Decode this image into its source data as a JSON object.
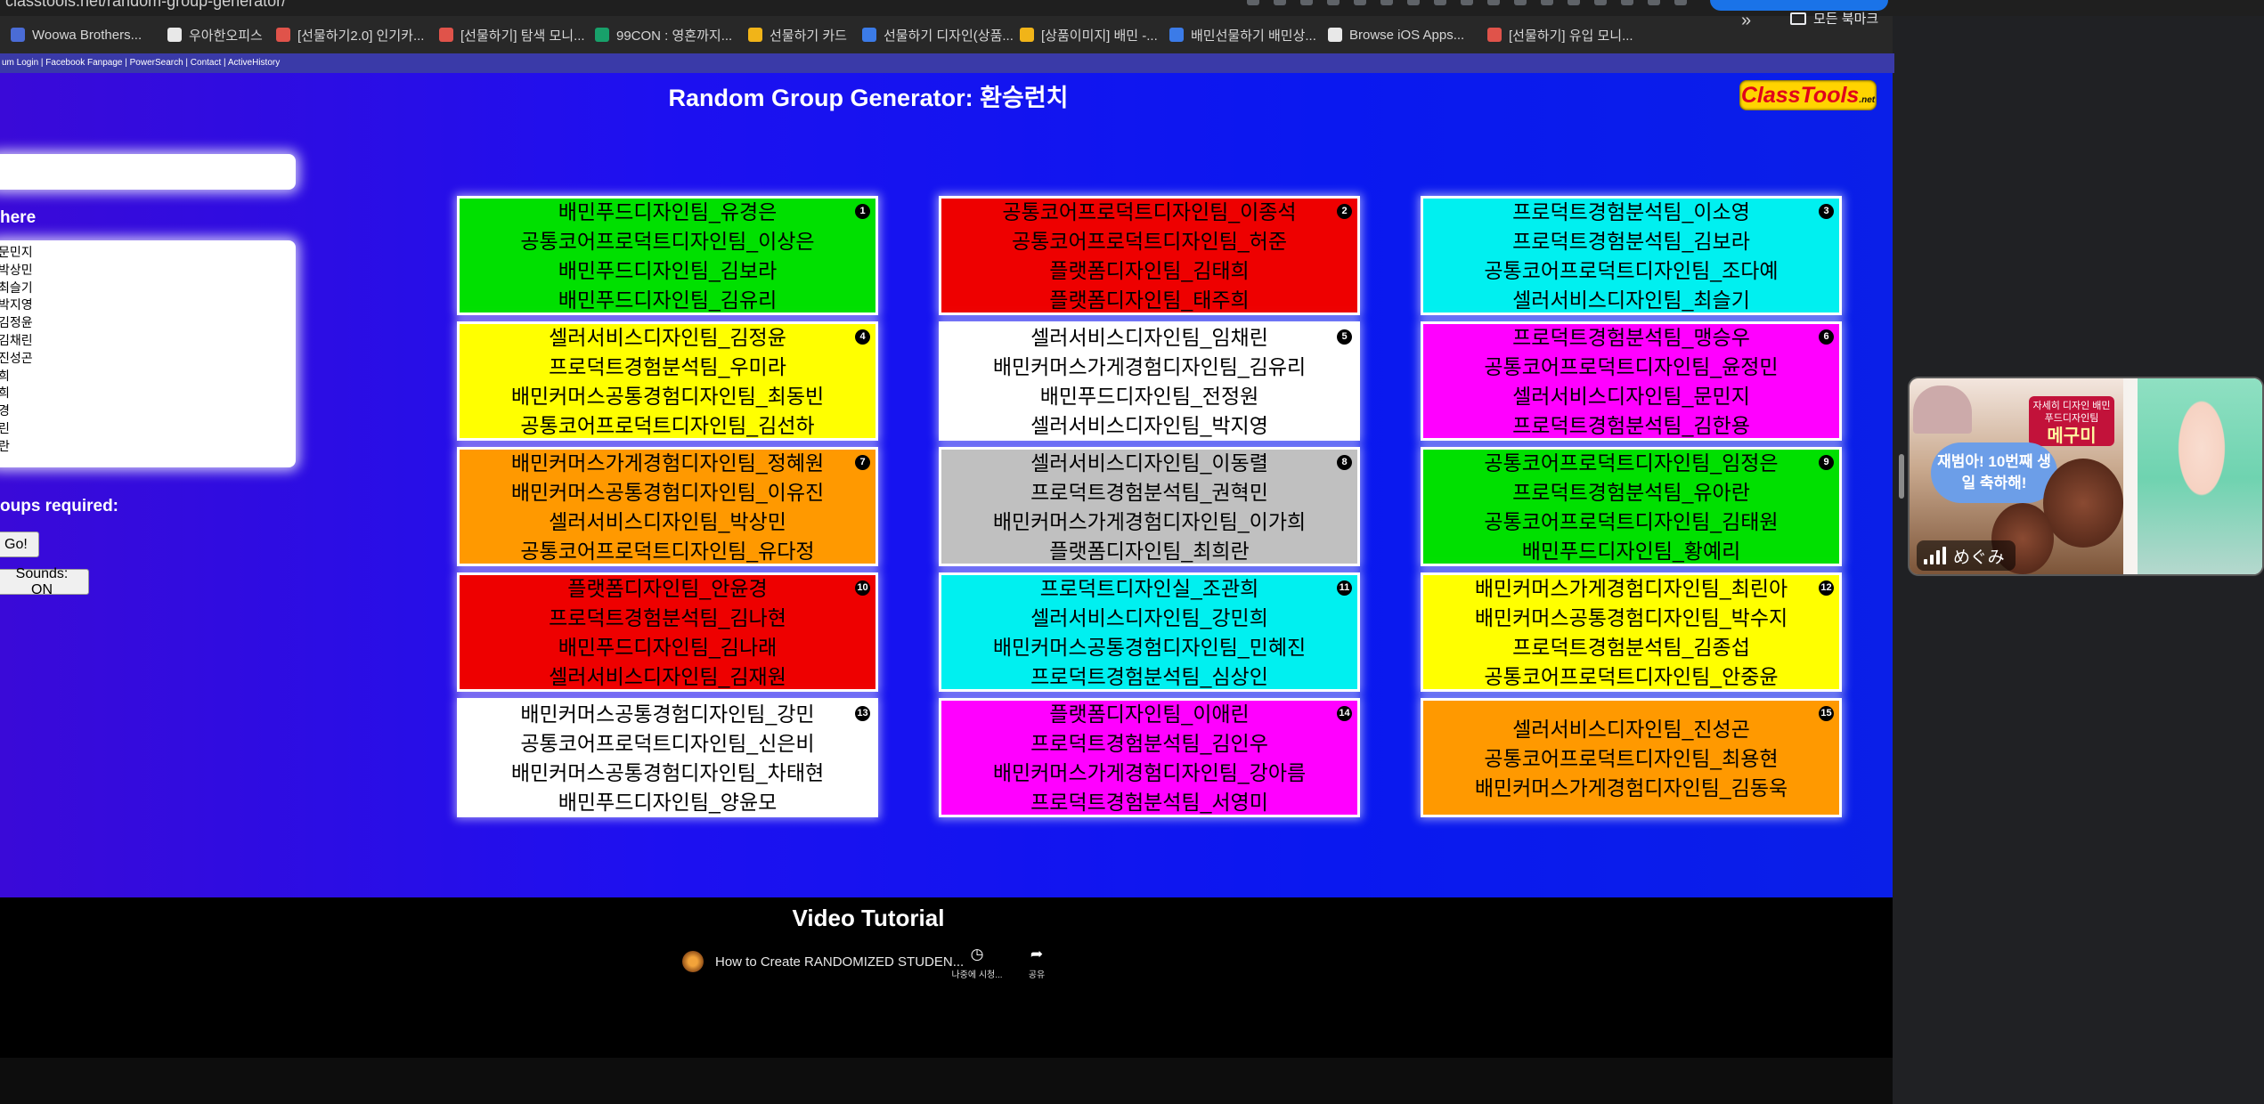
{
  "browser": {
    "url_fragment": "classtools.net/random-group-generator/",
    "bookmarks": [
      {
        "label": "Woowa Brothers...",
        "color": "#4a6cd6",
        "icon": "woowa-icon"
      },
      {
        "label": "우아한오피스",
        "color": "#e8e8e8",
        "icon": "office-icon"
      },
      {
        "label": "[선물하기2.0] 인기카...",
        "color": "#e0534a",
        "icon": "gift-icon"
      },
      {
        "label": "[선물하기] 탐색 모니...",
        "color": "#e0534a",
        "icon": "gift-icon"
      },
      {
        "label": "99CON : 영혼까지...",
        "color": "#18a06a",
        "icon": "99con-icon"
      },
      {
        "label": "선물하기 카드",
        "color": "#f1b418",
        "icon": "drive-icon"
      },
      {
        "label": "선물하기 디자인(상품...",
        "color": "#3b7be8",
        "icon": "confluence-icon"
      },
      {
        "label": "[상품이미지] 배민 -...",
        "color": "#f1b418",
        "icon": "drive-icon"
      },
      {
        "label": "배민선물하기 배민상...",
        "color": "#3b7be8",
        "icon": "confluence-icon"
      },
      {
        "label": "Browse iOS Apps...",
        "color": "#e8e8e8",
        "icon": "mobbin-icon"
      },
      {
        "label": "[선물하기] 유입 모니...",
        "color": "#e0534a",
        "icon": "gift-icon"
      }
    ],
    "more_label": "»",
    "all_bookmarks_label": "모든 북마크"
  },
  "page": {
    "infobar": "um Login | Facebook Fanpage | PowerSearch | Contact | ActiveHistory",
    "title": "Random Group Generator: 환승런치",
    "logo": "ClassTools",
    "logo_sub": ".net",
    "names_label": "here",
    "groups_label": "oups required:",
    "go_button": "Go!",
    "sounds_button": "Sounds: ON",
    "names_list": [
      "문민지",
      "박상민",
      "최슬기",
      "박지영",
      "김정윤",
      "김채린",
      "진성곤",
      "희",
      "희",
      "경",
      "린",
      "란"
    ]
  },
  "groups": [
    {
      "number": "1",
      "color": "#00e000",
      "members": [
        "배민푸드디자인팀_유경은",
        "공통코어프로덕트디자인팀_이상은",
        "배민푸드디자인팀_김보라",
        "배민푸드디자인팀_김유리"
      ]
    },
    {
      "number": "2",
      "color": "#ee0000",
      "members": [
        "공통코어프로덕트디자인팀_이종석",
        "공통코어프로덕트디자인팀_허준",
        "플랫폼디자인팀_김태희",
        "플랫폼디자인팀_태주희"
      ]
    },
    {
      "number": "3",
      "color": "#00f0f0",
      "members": [
        "프로덕트경험분석팀_이소영",
        "프로덕트경험분석팀_김보라",
        "공통코어프로덕트디자인팀_조다예",
        "셀러서비스디자인팀_최슬기"
      ]
    },
    {
      "number": "4",
      "color": "#ffff00",
      "members": [
        "셀러서비스디자인팀_김정윤",
        "프로덕트경험분석팀_우미라",
        "배민커머스공통경험디자인팀_최동빈",
        "공통코어프로덕트디자인팀_김선하"
      ]
    },
    {
      "number": "5",
      "color": "#ffffff",
      "members": [
        "셀러서비스디자인팀_임채린",
        "배민커머스가게경험디자인팀_김유리",
        "배민푸드디자인팀_전정원",
        "셀러서비스디자인팀_박지영"
      ]
    },
    {
      "number": "6",
      "color": "#ff00ff",
      "members": [
        "프로덕트경험분석팀_맹승우",
        "공통코어프로덕트디자인팀_윤정민",
        "셀러서비스디자인팀_문민지",
        "프로덕트경험분석팀_김한용"
      ]
    },
    {
      "number": "7",
      "color": "#ff9900",
      "members": [
        "배민커머스가게경험디자인팀_정혜원",
        "배민커머스공통경험디자인팀_이유진",
        "셀러서비스디자인팀_박상민",
        "공통코어프로덕트디자인팀_유다정"
      ]
    },
    {
      "number": "8",
      "color": "#c0c0c0",
      "members": [
        "셀러서비스디자인팀_이동렬",
        "프로덕트경험분석팀_권혁민",
        "배민커머스가게경험디자인팀_이가희",
        "플랫폼디자인팀_최희란"
      ]
    },
    {
      "number": "9",
      "color": "#00e000",
      "members": [
        "공통코어프로덕트디자인팀_임정은",
        "프로덕트경험분석팀_유아란",
        "공통코어프로덕트디자인팀_김태원",
        "배민푸드디자인팀_황예리"
      ]
    },
    {
      "number": "10",
      "color": "#ee0000",
      "members": [
        "플랫폼디자인팀_안윤경",
        "프로덕트경험분석팀_김나현",
        "배민푸드디자인팀_김나래",
        "셀러서비스디자인팀_김재원"
      ]
    },
    {
      "number": "11",
      "color": "#00f0f0",
      "members": [
        "프로덕트디자인실_조관희",
        "셀러서비스디자인팀_강민희",
        "배민커머스공통경험디자인팀_민혜진",
        "프로덕트경험분석팀_심상인"
      ]
    },
    {
      "number": "12",
      "color": "#ffff00",
      "members": [
        "배민커머스가게경험디자인팀_최린아",
        "배민커머스공통경험디자인팀_박수지",
        "프로덕트경험분석팀_김종섭",
        "공통코어프로덕트디자인팀_안중윤"
      ]
    },
    {
      "number": "13",
      "color": "#ffffff",
      "members": [
        "배민커머스공통경험디자인팀_강민",
        "공통코어프로덕트디자인팀_신은비",
        "배민커머스공통경험디자인팀_차태현",
        "배민푸드디자인팀_양윤모"
      ]
    },
    {
      "number": "14",
      "color": "#ff00ff",
      "members": [
        "플랫폼디자인팀_이애린",
        "프로덕트경험분석팀_김인우",
        "배민커머스가게경험디자인팀_강아름",
        "프로덕트경험분석팀_서영미"
      ]
    },
    {
      "number": "15",
      "color": "#ff9900",
      "members": [
        "셀러서비스디자인팀_진성곤",
        "공통코어프로덕트디자인팀_최용현",
        "배민커머스가게경험디자인팀_김동욱"
      ]
    }
  ],
  "video": {
    "section_title": "Video Tutorial",
    "name": "How to Create RANDOMIZED STUDEN...",
    "watch_later": "나중에 시청...",
    "share": "공유"
  },
  "call": {
    "participant": "めぐみ",
    "bubble": "재범아! 10번째 생일 축하해!",
    "tag_top": "자세히 디자인 배민푸드디자인팀",
    "tag_name": "메구미"
  }
}
